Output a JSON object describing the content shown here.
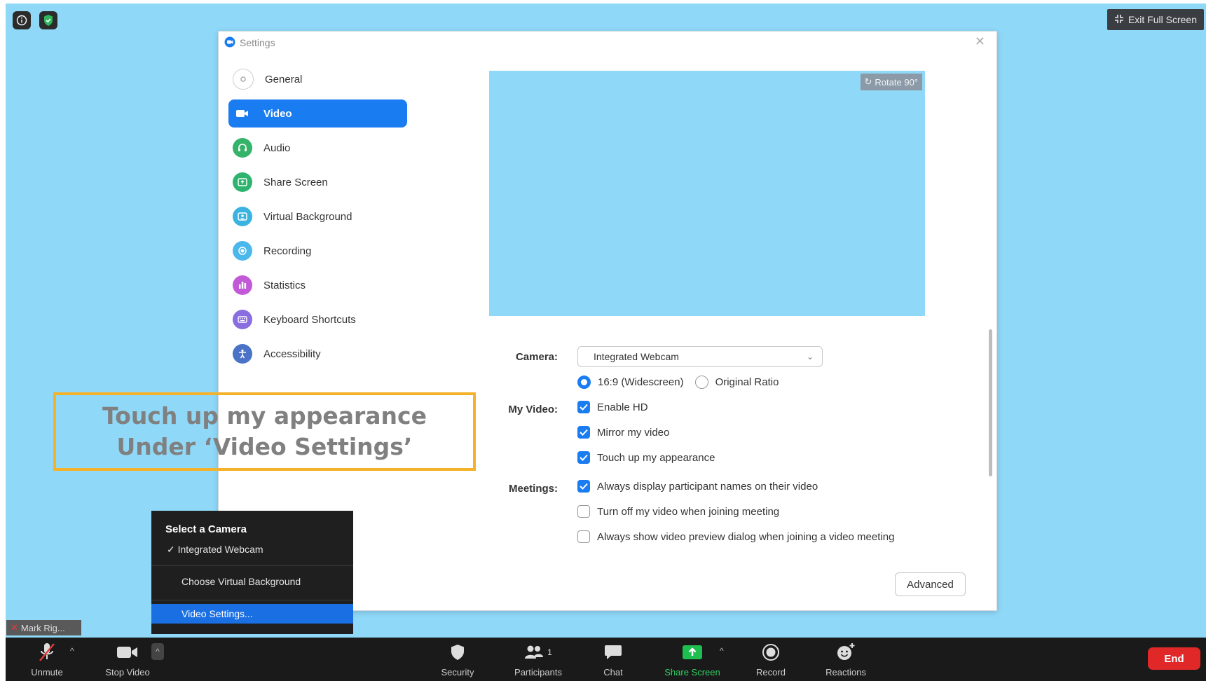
{
  "top_bar": {
    "info_icon": "info-icon",
    "security_badge_icon": "shield-check-icon",
    "exit_full_screen": "Exit Full Screen"
  },
  "settings": {
    "title": "Settings",
    "nav": [
      {
        "label": "General",
        "icon": "gear-icon",
        "color": "#bdbdbd"
      },
      {
        "label": "Video",
        "icon": "video-camera-icon",
        "color": "#1a7cf1",
        "active": true
      },
      {
        "label": "Audio",
        "icon": "headphones-icon",
        "color": "#35b36a"
      },
      {
        "label": "Share Screen",
        "icon": "share-screen-icon",
        "color": "#2fb46f"
      },
      {
        "label": "Virtual Background",
        "icon": "person-frame-icon",
        "color": "#3ab3e0"
      },
      {
        "label": "Recording",
        "icon": "record-icon",
        "color": "#4bb8ec"
      },
      {
        "label": "Statistics",
        "icon": "bar-chart-icon",
        "color": "#c25ad8"
      },
      {
        "label": "Keyboard Shortcuts",
        "icon": "keyboard-icon",
        "color": "#8a6ee0"
      },
      {
        "label": "Accessibility",
        "icon": "accessibility-icon",
        "color": "#4a72c7"
      }
    ],
    "video": {
      "rotate_label": "Rotate 90°",
      "camera_label": "Camera:",
      "camera_value": "Integrated Webcam",
      "ratio_widescreen": "16:9 (Widescreen)",
      "ratio_original": "Original Ratio",
      "my_video_label": "My Video:",
      "enable_hd": "Enable HD",
      "mirror": "Mirror my video",
      "touch_up": "Touch up my appearance",
      "meetings_label": "Meetings:",
      "display_names": "Always display participant names on their video",
      "turn_off_video": "Turn off my video when joining meeting",
      "show_preview": "Always show video preview dialog when joining a video meeting",
      "advanced": "Advanced"
    }
  },
  "annotation": {
    "line1": "Touch up my appearance",
    "line2": "Under ‘Video Settings’"
  },
  "camera_menu": {
    "header": "Select a Camera",
    "camera": "Integrated Webcam",
    "virtual_bg": "Choose Virtual Background",
    "video_settings": "Video Settings..."
  },
  "name_tag": "Mark Rig...",
  "toolbar": {
    "unmute": "Unmute",
    "stop_video": "Stop Video",
    "security": "Security",
    "participants": "Participants",
    "participants_count": "1",
    "chat": "Chat",
    "share_screen": "Share Screen",
    "record": "Record",
    "reactions": "Reactions",
    "end": "End"
  },
  "colors": {
    "accent": "#1a7cf1",
    "stage": "#8fd8f7",
    "annotation_border": "#f5b12a",
    "end": "#e02828",
    "share_green": "#1fbf4f"
  }
}
